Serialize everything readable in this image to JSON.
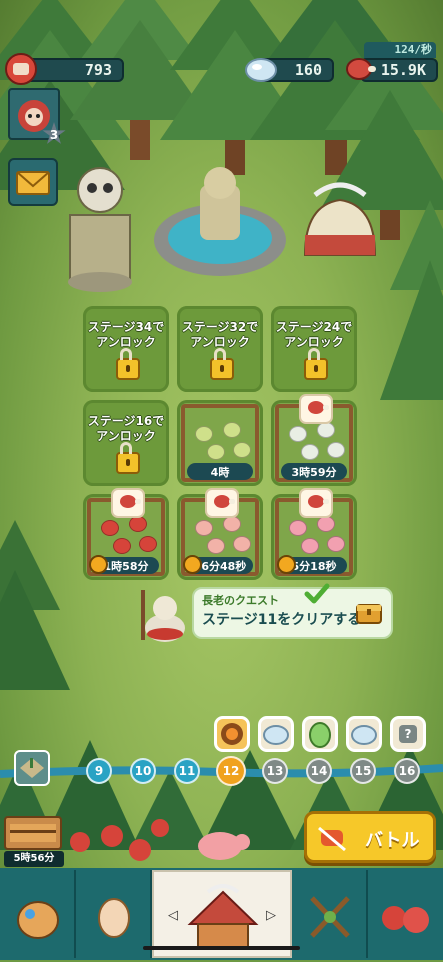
{
  "resources": {
    "strength": "793",
    "gems": "160",
    "meat": "15.9K",
    "meat_rate": "124/秒"
  },
  "player": {
    "level": "3"
  },
  "pens": [
    {
      "locked": true,
      "text": "ステージ34で\nアンロック"
    },
    {
      "locked": true,
      "text": "ステージ32で\nアンロック"
    },
    {
      "locked": true,
      "text": "ステージ24で\nアンロック"
    },
    {
      "locked": true,
      "text": "ステージ16で\nアンロック"
    },
    {
      "locked": false,
      "timer": "4時"
    },
    {
      "locked": false,
      "timer": "3時59分"
    },
    {
      "locked": false,
      "timer": "1時58分"
    },
    {
      "locked": false,
      "timer": "26分48秒"
    },
    {
      "locked": false,
      "timer": "5分18秒"
    }
  ],
  "quest": {
    "title": "長老のクエスト",
    "task": "ステージ11をクリアする"
  },
  "stages": [
    "9",
    "10",
    "11",
    "12",
    "13",
    "14",
    "15",
    "16"
  ],
  "current_stage": "12",
  "storage_timer": "5時56分",
  "battle_label": "バトル",
  "reward_unknown": "?",
  "colors": {
    "stat_bg": "#1f4a4e",
    "nav_bg": "#1d6a6d",
    "battle": "#f6c829",
    "stage_done": "#2aa3c4",
    "stage_current": "#f0a21e",
    "stage_locked": "#7f8a87"
  },
  "icons": {
    "strength": "fist-icon",
    "gems": "gem-icon",
    "meat": "meat-icon",
    "mail": "envelope-icon",
    "lock": "padlock-icon",
    "timer": "clock-icon",
    "check": "checkmark-icon",
    "chest": "treasure-chest-icon",
    "battle": "fist-icon"
  }
}
